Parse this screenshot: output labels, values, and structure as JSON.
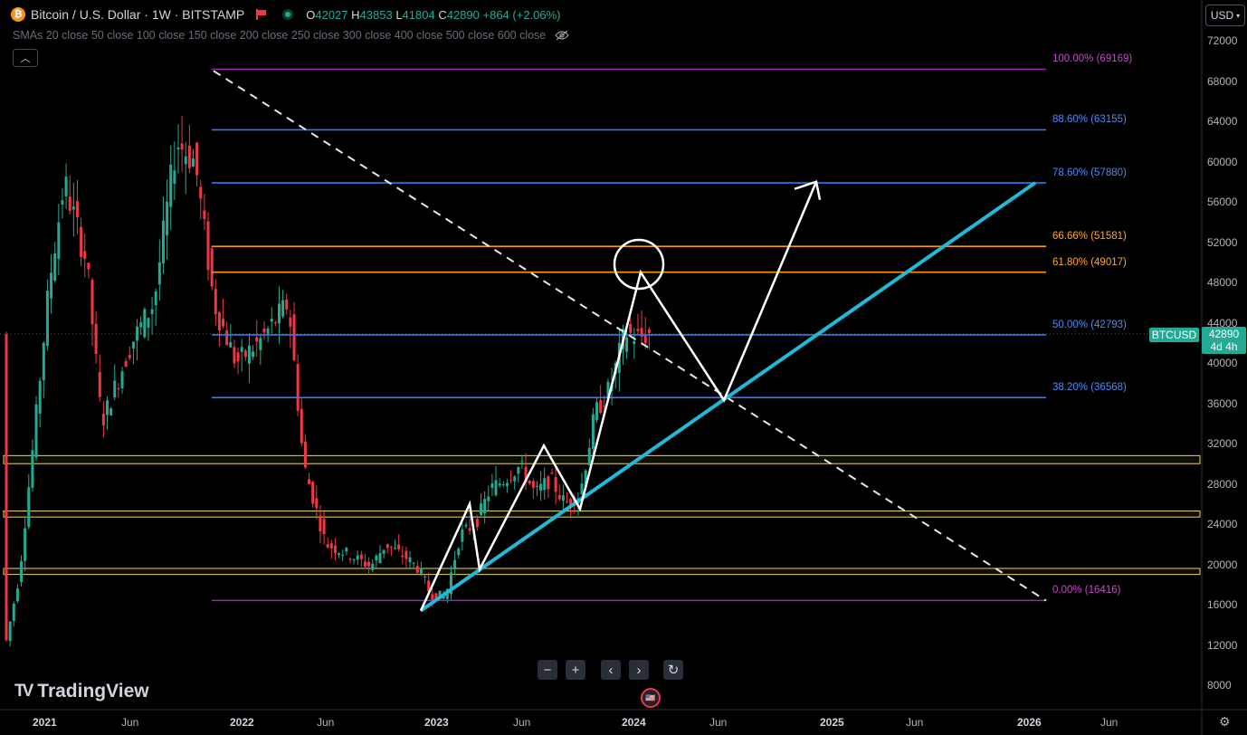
{
  "header": {
    "symbol_title": "Bitcoin / U.S. Dollar · 1W · BITSTAMP",
    "open_label": "O",
    "open": "42027",
    "high_label": "H",
    "high": "43853",
    "low_label": "L",
    "low": "41804",
    "close_label": "C",
    "close": "42890",
    "change": "+864 (+2.06%)",
    "indicators": "SMAs 20 close 50 close 100 close 150 close 200 close 250 close 300 close 400 close 500 close 600 close",
    "icons": [
      "bitcoin-icon",
      "flag-icon",
      "market-status-icon",
      "eye-off-icon",
      "chevron-up-icon"
    ]
  },
  "currency": "USD",
  "price_tag": {
    "symbol": "BTCUSD",
    "price": "42890",
    "countdown": "4d 4h"
  },
  "controls": {
    "zoom_out": "−",
    "zoom_in": "+",
    "scroll_left": "‹",
    "scroll_right": "›",
    "reset": "↻"
  },
  "brand": "TradingView",
  "colors": {
    "up": "#22ab94",
    "down": "#f23645",
    "fib_50": "#2962ff",
    "fib_orange": "#ff9800",
    "fib_purple": "#9c27b0",
    "trendline": "#00bcd4",
    "zone": "#ffeb3b"
  },
  "chart_data": {
    "type": "candlestick",
    "symbol": "BTCUSD",
    "interval": "1W",
    "y_axis": {
      "ticks": [
        8000,
        12000,
        16000,
        20000,
        24000,
        28000,
        32000,
        36000,
        40000,
        44000,
        48000,
        52000,
        56000,
        60000,
        64000,
        68000,
        72000
      ]
    },
    "x_axis": {
      "ticks": [
        "2021",
        "Jun",
        "2022",
        "Jun",
        "2023",
        "Jun",
        "2024",
        "Jun",
        "2025",
        "Jun",
        "2026",
        "Jun"
      ]
    },
    "fib_levels": [
      {
        "label": "100.00% (69169)",
        "price": 69169
      },
      {
        "label": "88.60% (63155)",
        "price": 63155
      },
      {
        "label": "78.60% (57880)",
        "price": 57880
      },
      {
        "label": "66.66% (51581)",
        "price": 51581
      },
      {
        "label": "61.80% (49017)",
        "price": 49017
      },
      {
        "label": "50.00% (42793)",
        "price": 42793
      },
      {
        "label": "38.20% (36568)",
        "price": 36568
      },
      {
        "label": "0.00% (16416)",
        "price": 16416
      }
    ],
    "support_zones": [
      {
        "from": 30000,
        "to": 30800
      },
      {
        "from": 24700,
        "to": 25300
      },
      {
        "from": 19000,
        "to": 19600
      }
    ],
    "trendlines": [
      {
        "name": "dashed-downtrend",
        "from": [
          "2021-11",
          69000
        ],
        "to": [
          "2026-02",
          16400
        ]
      },
      {
        "name": "rising-support",
        "from": [
          "2022-12",
          15400
        ],
        "to": [
          "2025-12",
          57900
        ]
      }
    ],
    "projection_path": [
      15400,
      26000,
      19500,
      31800,
      25500,
      49000,
      36300,
      58000
    ],
    "last_price": 42890
  }
}
